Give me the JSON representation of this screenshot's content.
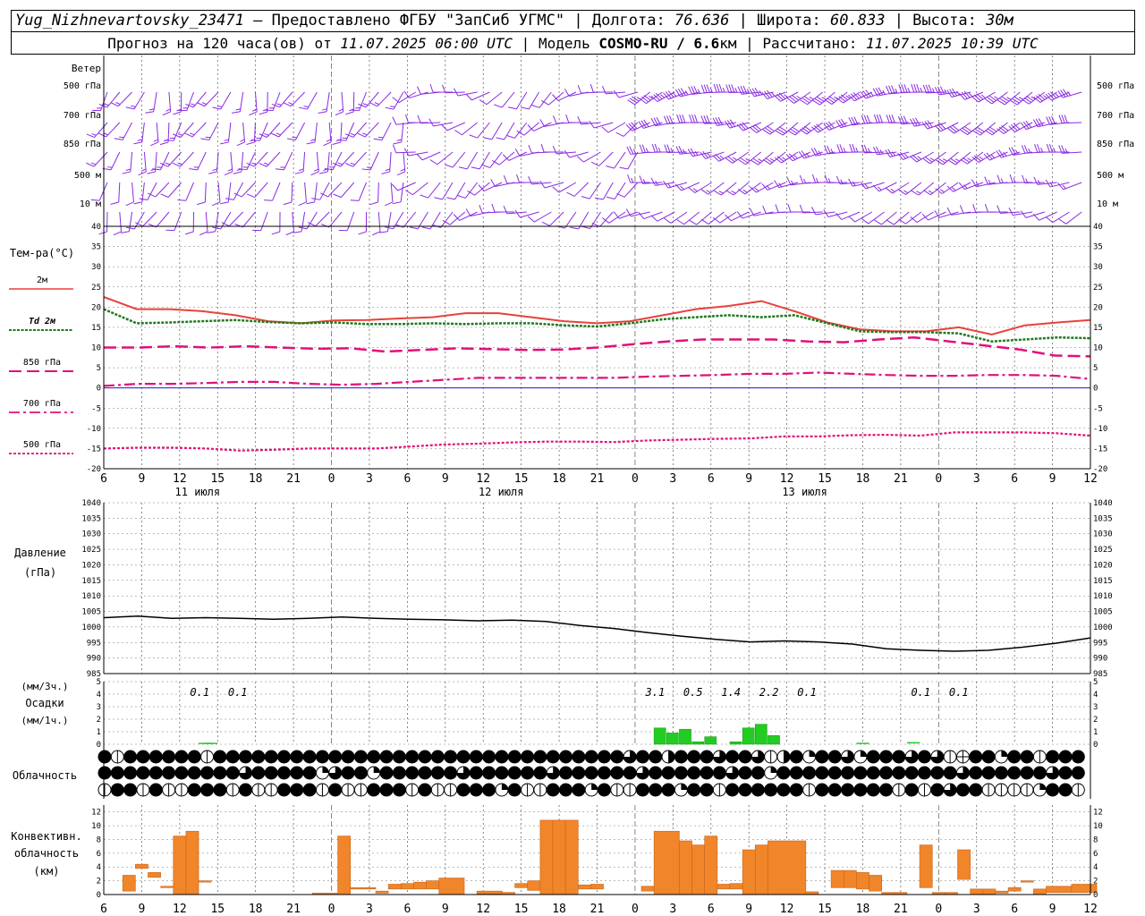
{
  "header": {
    "station": "Yug_Nizhnevartovsky_23471",
    "provider": "– Предоставлено ФГБУ \"ЗапСиб УГМС\"",
    "lon_label": "Долгота:",
    "lon": "76.636",
    "lat_label": "Широта:",
    "lat": "60.833",
    "alt_label": "Высота:",
    "alt": "30м",
    "forecast_label": "Прогноз на 120 часа(ов) от",
    "forecast_start": "11.07.2025 06:00 UTC",
    "model_label": "Модель",
    "model_name": "COSMO-RU / 6.6",
    "model_unit": "км",
    "calc_label": "Рассчитано:",
    "calc_time": "11.07.2025 10:39 UTC"
  },
  "wind_panel": {
    "title": "Ветер",
    "levels": [
      "500 гПа",
      "700 гПа",
      "850 гПа",
      "500 м",
      "10  м"
    ]
  },
  "temp_panel": {
    "title": "Тем-ра(°C)",
    "legend": [
      "2м",
      "Td  2м",
      "850 гПа",
      "700 гПа",
      "500 гПа"
    ]
  },
  "pressure_panel": {
    "title_line1": "Давление",
    "title_line2": "(гПа)"
  },
  "precip_panel": {
    "label_top": "(мм/3ч.)",
    "label_mid": "Осадки",
    "label_bot": "(мм/1ч.)"
  },
  "cloud_panel": {
    "title": "Облачность"
  },
  "conv_panel": {
    "title_line1": "Конвективн.",
    "title_line2": "облачность",
    "title_line3": "(км)"
  },
  "colors": {
    "wind": "#8a2be2",
    "t2m": "#e8413a",
    "td": "#1e7a1e",
    "t850": "#e0107a",
    "t700": "#e0107a",
    "t500": "#e0107a",
    "pressure": "#000000",
    "precip": "#22cc22",
    "conv": "#f0852a",
    "zero_line": "#1a1acc"
  },
  "chart_data": [
    {
      "type": "line",
      "name": "temperature",
      "x_ticks": [
        "6",
        "9",
        "12",
        "15",
        "18",
        "21",
        "0",
        "3",
        "6",
        "9",
        "12",
        "15",
        "18",
        "21",
        "0",
        "3",
        "6",
        "9",
        "12",
        "15",
        "18",
        "21",
        "0",
        "3",
        "6",
        "9",
        "12"
      ],
      "date_labels": [
        "11 июля",
        "12 июля",
        "13 июля"
      ],
      "y_ticks": [
        40,
        35,
        30,
        25,
        20,
        15,
        10,
        5,
        0,
        -5,
        -10,
        -15,
        -20
      ],
      "ylim": [
        -20,
        40
      ],
      "x_hours": [
        0,
        3,
        6,
        9,
        12,
        15,
        18,
        21,
        24,
        27,
        30,
        33,
        36,
        39,
        42,
        45,
        48,
        51,
        54,
        57,
        60,
        63,
        66,
        69,
        72,
        75,
        78
      ],
      "series": [
        {
          "name": "2м",
          "values": [
            22.5,
            19.5,
            19.5,
            19,
            18,
            16.5,
            16,
            16.7,
            16.8,
            17.2,
            17.5,
            18.5,
            18.5,
            17.5,
            16.5,
            16,
            16.5,
            18,
            19.5,
            20.3,
            21.5,
            19,
            16.2,
            14.5,
            14,
            14,
            15,
            13.2,
            15.5,
            16.2,
            16.8
          ]
        },
        {
          "name": "Td  2м",
          "values": [
            19.5,
            16,
            16.2,
            16.5,
            16.8,
            16.3,
            16,
            16.2,
            15.8,
            15.8,
            16,
            15.8,
            16,
            16,
            15.5,
            15.2,
            16,
            17,
            17.5,
            18,
            17.5,
            18,
            16,
            14,
            13.8,
            13.8,
            13.5,
            11.5,
            12,
            12.5,
            12.3
          ]
        },
        {
          "name": "850 гПа",
          "values": [
            10,
            10,
            10.3,
            10,
            10.3,
            10,
            9.7,
            9.8,
            9,
            9.4,
            9.8,
            9.6,
            9.4,
            9.5,
            10,
            10.8,
            11.5,
            12,
            12,
            12,
            11.5,
            11.3,
            12,
            12.5,
            11.5,
            10.5,
            9.5,
            8,
            7.8
          ]
        },
        {
          "name": "700 гПа",
          "values": [
            0.5,
            1,
            1,
            1.2,
            1.5,
            1.5,
            1,
            0.8,
            1,
            1.5,
            2,
            2.5,
            2.5,
            2.5,
            2.5,
            2.5,
            2.8,
            3,
            3.2,
            3.5,
            3.5,
            3.8,
            3.5,
            3.2,
            3,
            3,
            3.2,
            3.2,
            3,
            2.2
          ]
        },
        {
          "name": "500 гПа",
          "values": [
            -15,
            -14.8,
            -14.8,
            -15,
            -15.5,
            -15.3,
            -15,
            -15,
            -15,
            -14.5,
            -14,
            -13.8,
            -13.5,
            -13.3,
            -13.3,
            -13.4,
            -13,
            -12.8,
            -12.6,
            -12.5,
            -12,
            -12,
            -11.7,
            -11.6,
            -11.8,
            -11,
            -11,
            -11,
            -11.2,
            -11.8
          ]
        }
      ]
    },
    {
      "type": "line",
      "name": "pressure",
      "y_ticks": [
        1040,
        1035,
        1030,
        1025,
        1020,
        1015,
        1010,
        1005,
        1000,
        995,
        990,
        985
      ],
      "ylim": [
        985,
        1040
      ],
      "series": [
        {
          "values": [
            1003,
            1003.5,
            1002.8,
            1003,
            1002.8,
            1002.5,
            1002.8,
            1003.2,
            1002.8,
            1002.5,
            1002.3,
            1002,
            1002.2,
            1001.8,
            1000.5,
            999.5,
            998.2,
            997,
            996,
            995.2,
            995.5,
            995.2,
            994.5,
            993,
            992.5,
            992.2,
            992.5,
            993.5,
            994.8,
            996.5
          ]
        }
      ]
    },
    {
      "type": "bar",
      "name": "precipitation",
      "y_ticks": [
        5,
        4,
        3,
        2,
        1,
        0
      ],
      "ylim": [
        0,
        5
      ],
      "accum_labels": [
        {
          "hour": 9,
          "value": "0.1"
        },
        {
          "hour": 12,
          "value": "0.1"
        },
        {
          "hour": 45,
          "value": "3.1"
        },
        {
          "hour": 48,
          "value": "0.5"
        },
        {
          "hour": 51,
          "value": "1.4"
        },
        {
          "hour": 54,
          "value": "2.2"
        },
        {
          "hour": 57,
          "value": "0.1"
        },
        {
          "hour": 66,
          "value": "0.1"
        },
        {
          "hour": 69,
          "value": "0.1"
        }
      ],
      "bars": [
        {
          "hour": 44,
          "value": 1.3
        },
        {
          "hour": 45,
          "value": 0.9
        },
        {
          "hour": 46,
          "value": 1.2
        },
        {
          "hour": 47,
          "value": 0.2
        },
        {
          "hour": 48,
          "value": 0.6
        },
        {
          "hour": 50,
          "value": 0.2
        },
        {
          "hour": 51,
          "value": 1.3
        },
        {
          "hour": 52,
          "value": 1.6
        },
        {
          "hour": 53,
          "value": 0.7
        }
      ]
    },
    {
      "type": "bar",
      "name": "convective_cloud",
      "y_ticks": [
        12,
        10,
        8,
        6,
        4,
        2,
        0
      ],
      "ylim": [
        0,
        13
      ],
      "bars": [
        {
          "from": 1.5,
          "to": 2.5,
          "bottom": 0.5,
          "top": 2.8
        },
        {
          "from": 2.5,
          "to": 3.5,
          "bottom": 3.8,
          "top": 4.4
        },
        {
          "from": 3.5,
          "to": 4.5,
          "bottom": 2.5,
          "top": 3.2
        },
        {
          "from": 4.5,
          "to": 5.5,
          "bottom": 1,
          "top": 1.2
        },
        {
          "from": 5.5,
          "to": 6.5,
          "bottom": 0,
          "top": 8.5
        },
        {
          "from": 6.5,
          "to": 7.5,
          "bottom": 0,
          "top": 9.2
        },
        {
          "from": 7.5,
          "to": 8.5,
          "bottom": 1.8,
          "top": 2
        },
        {
          "from": 16.5,
          "to": 17.5,
          "bottom": 0,
          "top": 0.2
        },
        {
          "from": 17.5,
          "to": 18.5,
          "bottom": 0,
          "top": 0.2
        },
        {
          "from": 18.5,
          "to": 19.5,
          "bottom": 0,
          "top": 8.5
        },
        {
          "from": 19.5,
          "to": 20.5,
          "bottom": 0.8,
          "top": 1
        },
        {
          "from": 20.5,
          "to": 21.5,
          "bottom": 0.8,
          "top": 1
        },
        {
          "from": 21.5,
          "to": 22.5,
          "bottom": 0.2,
          "top": 0.5
        },
        {
          "from": 22.5,
          "to": 23.5,
          "bottom": 0.8,
          "top": 1.5
        },
        {
          "from": 23.5,
          "to": 24.5,
          "bottom": 0.8,
          "top": 1.6
        },
        {
          "from": 24.5,
          "to": 25.5,
          "bottom": 0.8,
          "top": 1.8
        },
        {
          "from": 25.5,
          "to": 26.5,
          "bottom": 0.8,
          "top": 2
        },
        {
          "from": 26.5,
          "to": 28.5,
          "bottom": 0,
          "top": 2.4
        },
        {
          "from": 29.5,
          "to": 31.5,
          "bottom": 0.1,
          "top": 0.5
        },
        {
          "from": 31.5,
          "to": 32.5,
          "bottom": 0,
          "top": 0.3
        },
        {
          "from": 32.5,
          "to": 33.5,
          "bottom": 1,
          "top": 1.6
        },
        {
          "from": 33.5,
          "to": 34.5,
          "bottom": 0.6,
          "top": 2
        },
        {
          "from": 34.5,
          "to": 35.5,
          "bottom": 0,
          "top": 10.8
        },
        {
          "from": 35.5,
          "to": 36.5,
          "bottom": 0,
          "top": 10.8
        },
        {
          "from": 36.5,
          "to": 37.5,
          "bottom": 0,
          "top": 10.8
        },
        {
          "from": 37.5,
          "to": 38.5,
          "bottom": 0.8,
          "top": 1.4
        },
        {
          "from": 38.5,
          "to": 39.5,
          "bottom": 0.8,
          "top": 1.5
        },
        {
          "from": 42.5,
          "to": 43.5,
          "bottom": 0.5,
          "top": 1.2
        },
        {
          "from": 43.5,
          "to": 45.5,
          "bottom": 0,
          "top": 9.2
        },
        {
          "from": 45.5,
          "to": 46.5,
          "bottom": 0,
          "top": 7.8
        },
        {
          "from": 46.5,
          "to": 47.5,
          "bottom": 0,
          "top": 7.2
        },
        {
          "from": 47.5,
          "to": 48.5,
          "bottom": 0,
          "top": 8.5
        },
        {
          "from": 48.5,
          "to": 49.5,
          "bottom": 0.8,
          "top": 1.5
        },
        {
          "from": 49.5,
          "to": 50.5,
          "bottom": 0.8,
          "top": 1.6
        },
        {
          "from": 50.5,
          "to": 51.5,
          "bottom": 0,
          "top": 6.5
        },
        {
          "from": 51.5,
          "to": 52.5,
          "bottom": 0,
          "top": 7.2
        },
        {
          "from": 52.5,
          "to": 55.5,
          "bottom": 0,
          "top": 7.8
        },
        {
          "from": 55.5,
          "to": 56.5,
          "bottom": 0,
          "top": 0.4
        },
        {
          "from": 57.5,
          "to": 58.5,
          "bottom": 1,
          "top": 3.5
        },
        {
          "from": 58.5,
          "to": 59.5,
          "bottom": 1,
          "top": 3.5
        },
        {
          "from": 59.5,
          "to": 60.5,
          "bottom": 0.8,
          "top": 3.2
        },
        {
          "from": 60.5,
          "to": 61.5,
          "bottom": 0.5,
          "top": 2.8
        },
        {
          "from": 61.5,
          "to": 62.5,
          "bottom": 0,
          "top": 0.3
        },
        {
          "from": 62.5,
          "to": 63.5,
          "bottom": 0,
          "top": 0.3
        },
        {
          "from": 64.5,
          "to": 65.5,
          "bottom": 1,
          "top": 7.2
        },
        {
          "from": 65.5,
          "to": 66.5,
          "bottom": 0,
          "top": 0.3
        },
        {
          "from": 66.5,
          "to": 67.5,
          "bottom": 0,
          "top": 0.3
        },
        {
          "from": 67.5,
          "to": 68.5,
          "bottom": 2.2,
          "top": 6.5
        },
        {
          "from": 68.5,
          "to": 69.5,
          "bottom": 0,
          "top": 0.8
        },
        {
          "from": 69.5,
          "to": 70.5,
          "bottom": 0,
          "top": 0.8
        },
        {
          "from": 70.5,
          "to": 71.5,
          "bottom": 0.2,
          "top": 0.5
        },
        {
          "from": 71.5,
          "to": 72.5,
          "bottom": 0.5,
          "top": 1
        },
        {
          "from": 72.5,
          "to": 73.5,
          "bottom": 1.8,
          "top": 2
        },
        {
          "from": 73.5,
          "to": 74.5,
          "bottom": 0,
          "top": 0.8
        },
        {
          "from": 74.5,
          "to": 76.5,
          "bottom": 0.3,
          "top": 1.2
        },
        {
          "from": 76.5,
          "to": 78.5,
          "bottom": 0.3,
          "top": 1.5
        }
      ]
    }
  ]
}
